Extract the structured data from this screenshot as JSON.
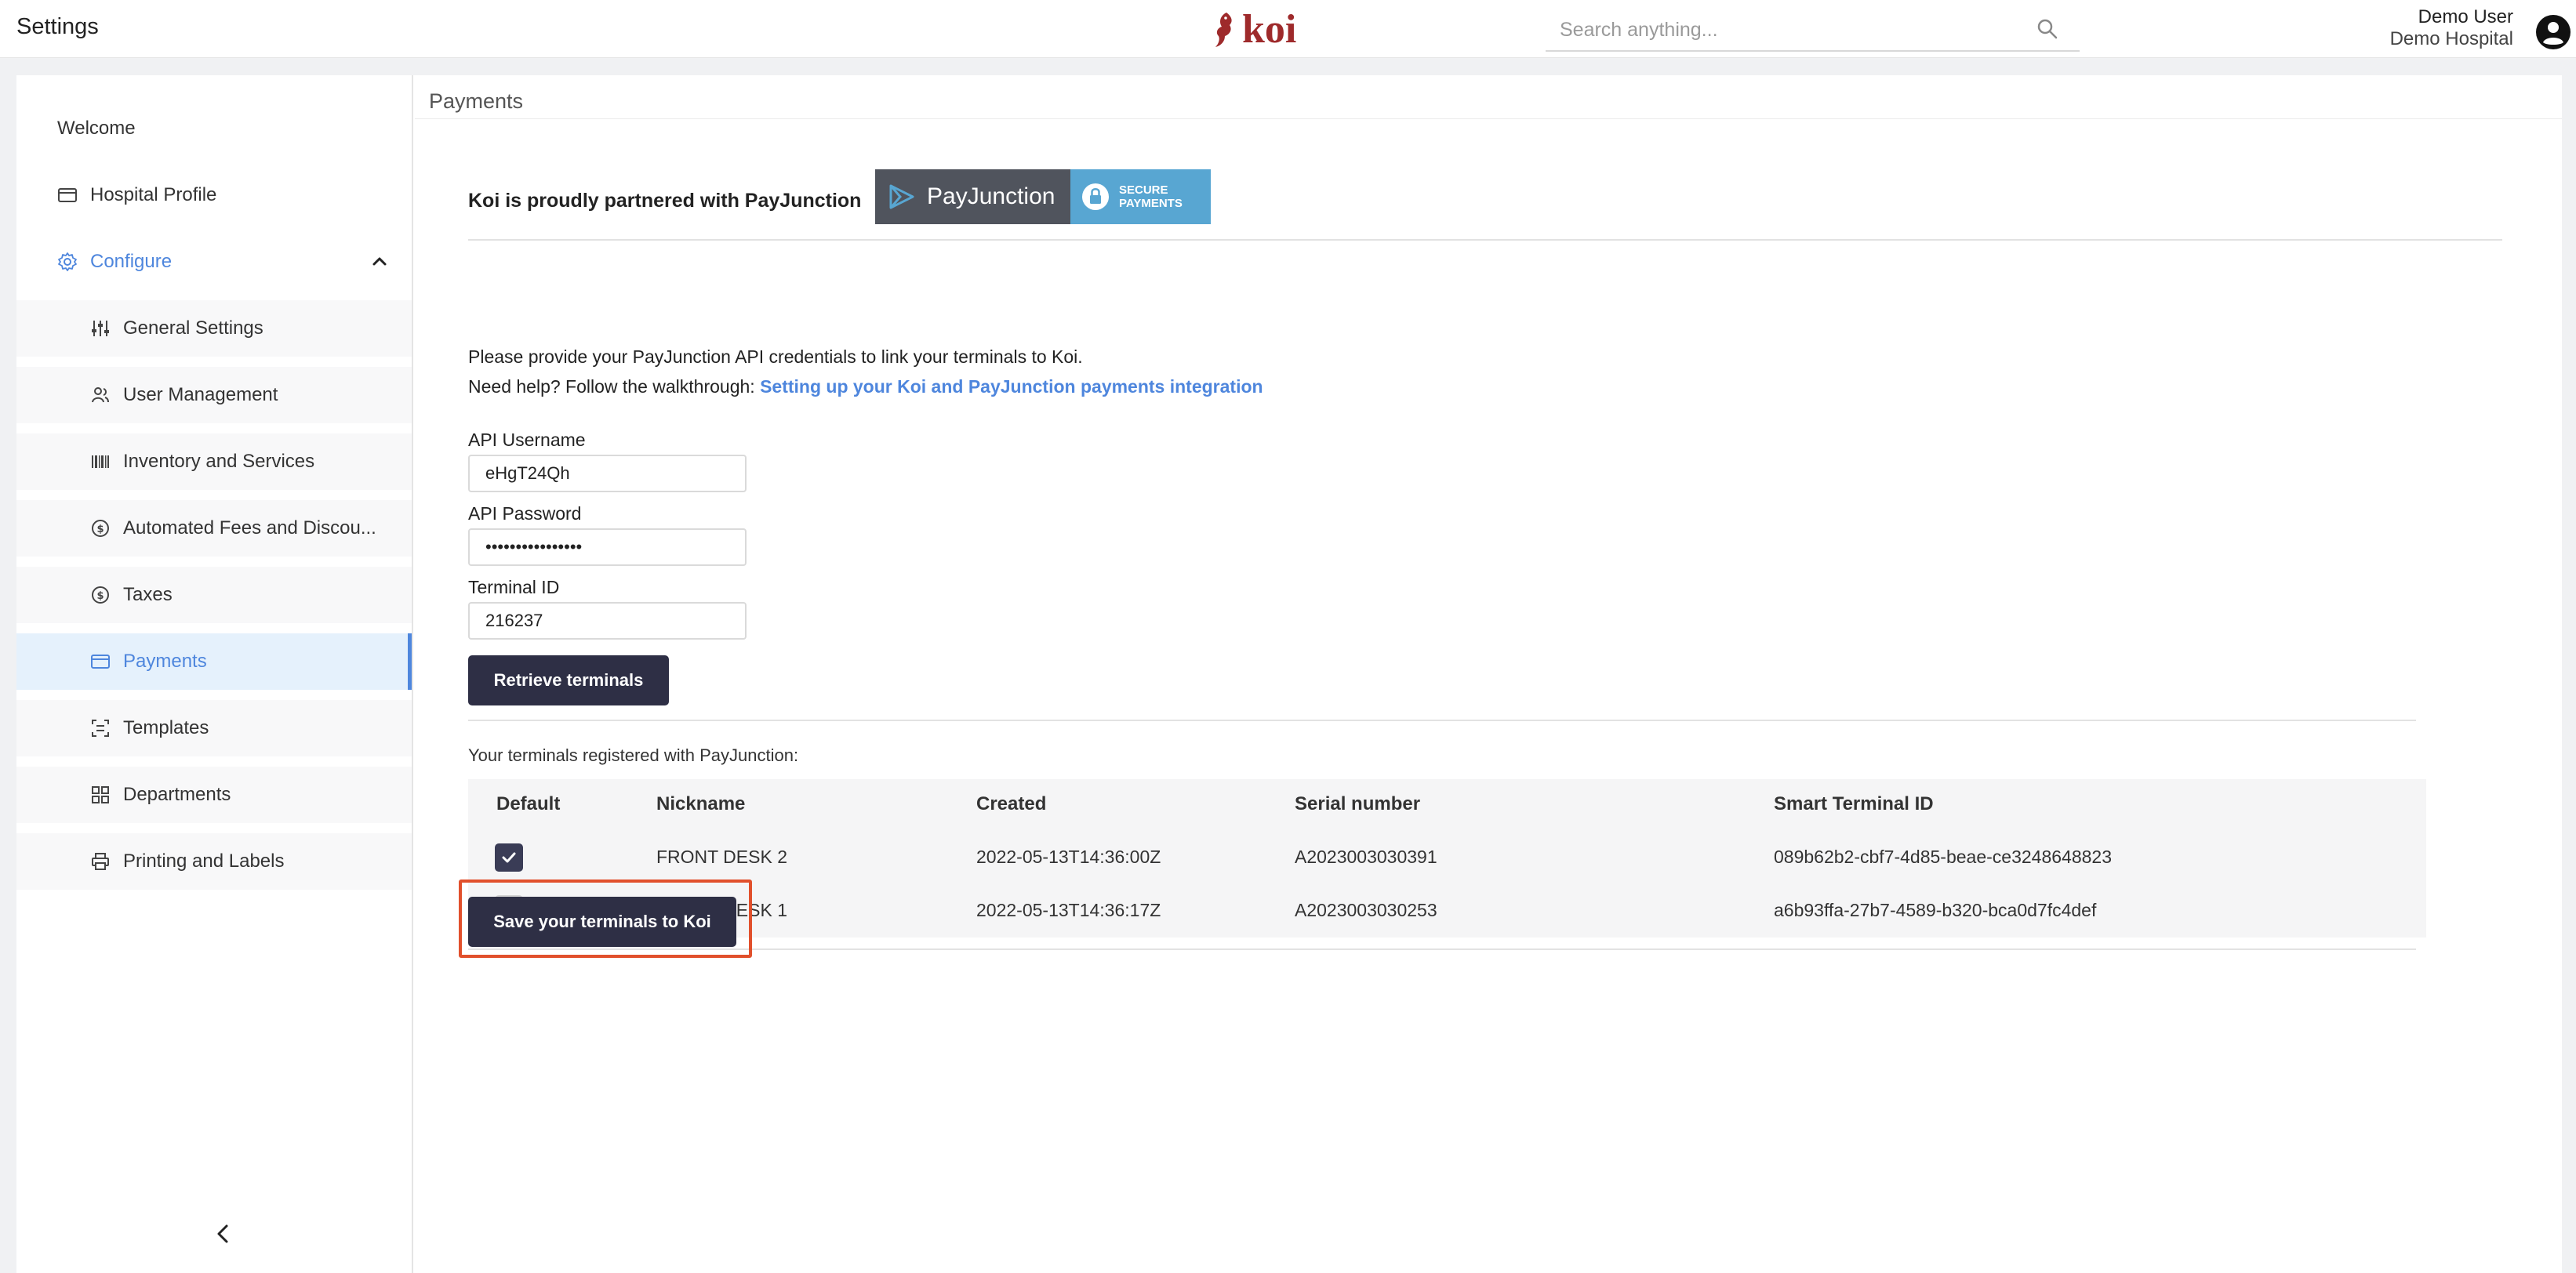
{
  "header": {
    "app_title": "Settings",
    "logo_text": "koi",
    "search_placeholder": "Search anything...",
    "user_name": "Demo User",
    "user_org": "Demo Hospital"
  },
  "sidebar": {
    "items": [
      {
        "label": "Welcome",
        "icon": "none"
      },
      {
        "label": "Hospital Profile",
        "icon": "id-card-icon"
      },
      {
        "label": "Configure",
        "icon": "gear-icon"
      },
      {
        "label": "General Settings",
        "icon": "sliders-icon"
      },
      {
        "label": "User Management",
        "icon": "users-icon"
      },
      {
        "label": "Inventory and Services",
        "icon": "barcode-icon"
      },
      {
        "label": "Automated Fees and Discou...",
        "icon": "dollar-circle-icon"
      },
      {
        "label": "Taxes",
        "icon": "dollar-circle-icon"
      },
      {
        "label": "Payments",
        "icon": "card-icon"
      },
      {
        "label": "Templates",
        "icon": "template-icon"
      },
      {
        "label": "Departments",
        "icon": "grid-icon"
      },
      {
        "label": "Printing and Labels",
        "icon": "printer-icon"
      }
    ],
    "active_item": "Payments",
    "accent_color": "#4e86dd"
  },
  "main": {
    "page_title": "Payments",
    "partner_text": "Koi is proudly partnered with PayJunction",
    "partner_badge": {
      "brand": "PayJunction",
      "secure_line1": "SECURE",
      "secure_line2": "PAYMENTS"
    },
    "intro_text": "Please provide your PayJunction API credentials to link your terminals to Koi.",
    "help_prefix": "Need help? Follow the walkthrough: ",
    "help_link": "Setting up your Koi and PayJunction payments integration",
    "fields": {
      "username_label": "API Username",
      "username_value": "eHgT24Qh",
      "password_label": "API Password",
      "password_value": "••••••••••••••••",
      "terminal_label": "Terminal ID",
      "terminal_value": "216237"
    },
    "retrieve_button": "Retrieve terminals",
    "terminals_label": "Your terminals registered with PayJunction:",
    "table": {
      "columns": [
        "Default",
        "Nickname",
        "Created",
        "Serial number",
        "Smart Terminal ID"
      ],
      "rows": [
        {
          "default": true,
          "nickname": "FRONT DESK 2",
          "created": "2022-05-13T14:36:00Z",
          "serial": "A2023003030391",
          "smart_id": "089b62b2-cbf7-4d85-beae-ce3248648823"
        },
        {
          "default": false,
          "nickname": "FRONT DESK 1",
          "created": "2022-05-13T14:36:17Z",
          "serial": "A2023003030253",
          "smart_id": "a6b93ffa-27b7-4589-b320-bca0d7fc4def"
        }
      ]
    },
    "save_button": "Save your terminals to Koi",
    "highlight_color": "#e1502c"
  }
}
